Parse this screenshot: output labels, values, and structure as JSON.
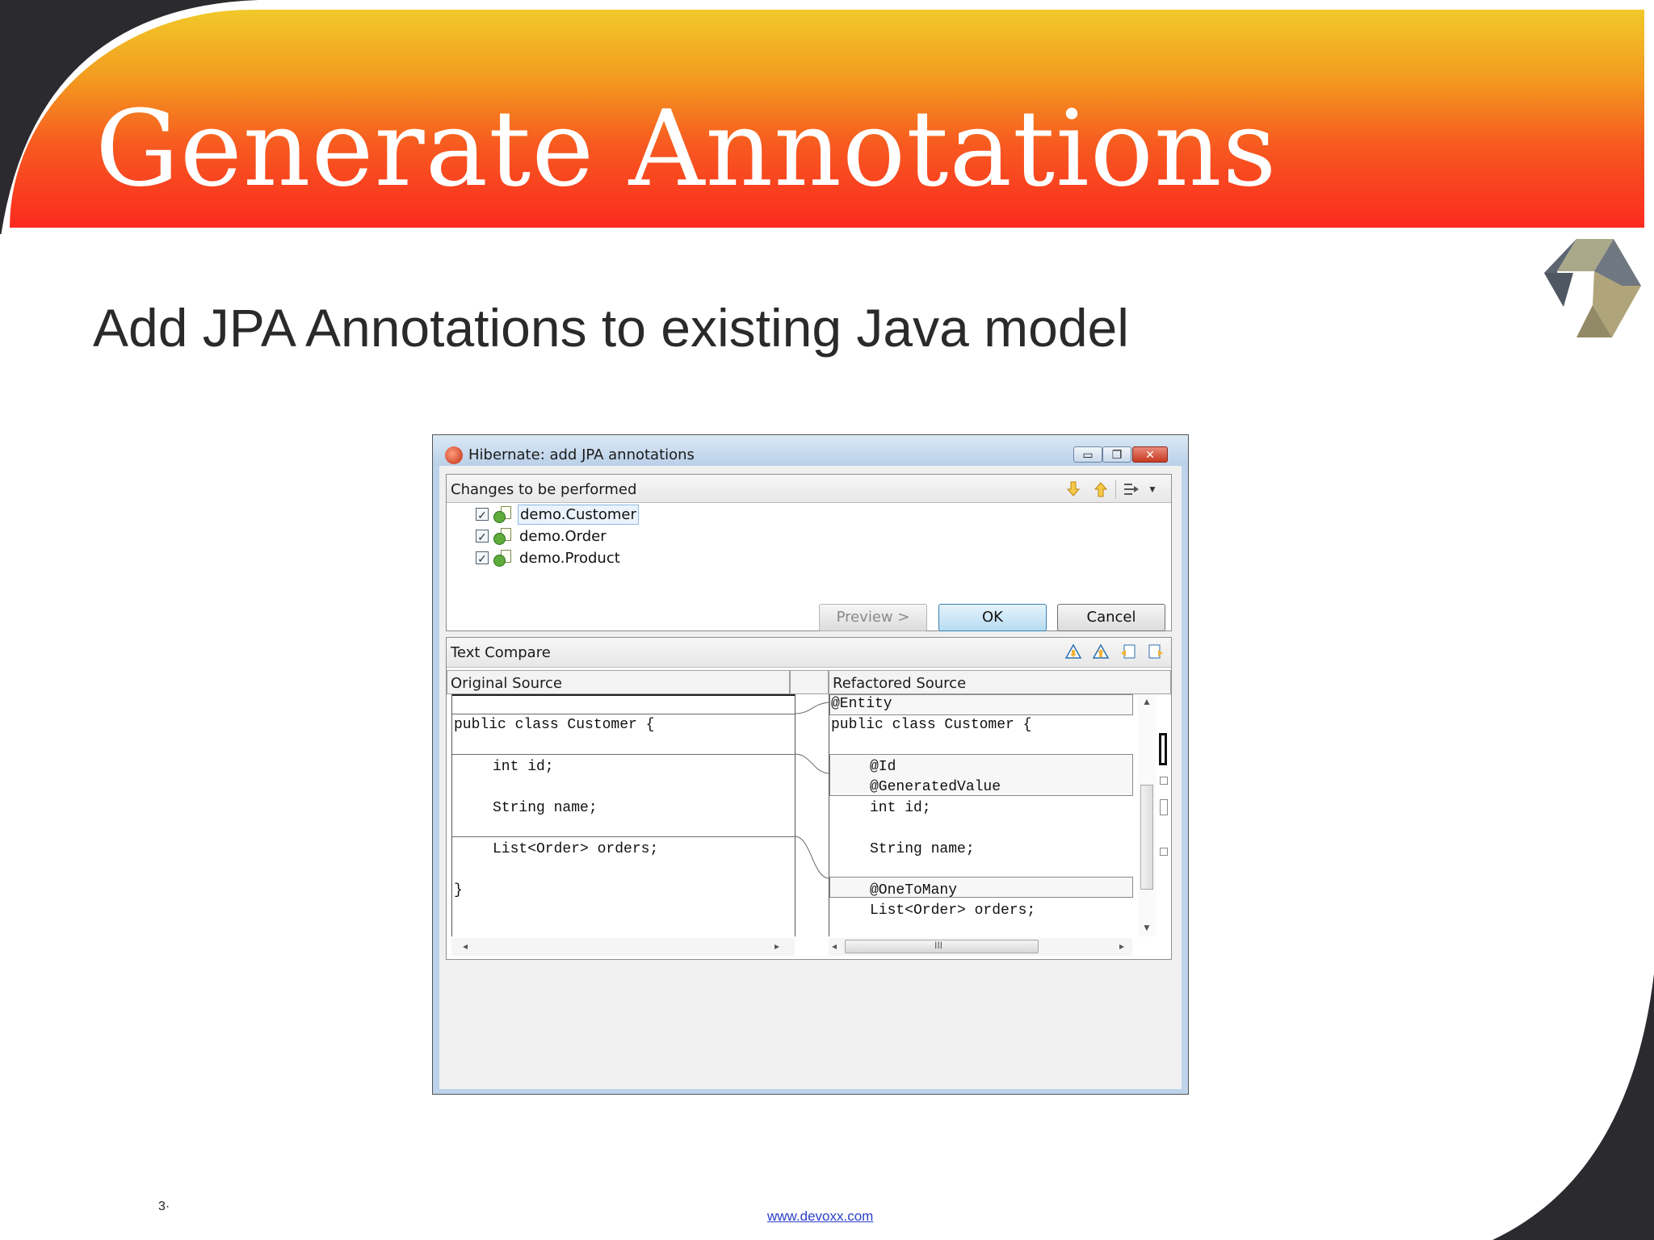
{
  "slide": {
    "title": "Generate Annotations",
    "subtitle": "Add JPA Annotations to existing Java model",
    "page_number": "3·",
    "footer_link": "www.devoxx.com"
  },
  "colors": {
    "header_top": "#f1c92a",
    "header_bottom": "#fb2a1f",
    "corner_dark": "#2b2b2f",
    "ok_button": "#b7dcf2"
  },
  "dialog": {
    "title": "Hibernate: add JPA annotations",
    "window_buttons": {
      "minimize": "▭",
      "maximize": "❐",
      "close": "✕"
    },
    "changes": {
      "header": "Changes to be performed",
      "toolbar_icons": [
        "arrow-down-icon",
        "arrow-up-icon",
        "filter-icon",
        "dropdown-icon"
      ],
      "items": [
        {
          "label": "demo.Customer",
          "checked": true,
          "selected": true
        },
        {
          "label": "demo.Order",
          "checked": true,
          "selected": false
        },
        {
          "label": "demo.Product",
          "checked": true,
          "selected": false
        }
      ]
    },
    "compare": {
      "header": "Text Compare",
      "toolbar_icons": [
        "next-diff-icon",
        "previous-diff-icon",
        "copy-left-icon",
        "copy-right-icon"
      ],
      "left_title": "Original Source",
      "right_title": "Refactored Source",
      "left_lines": [
        "public class Customer {",
        "int id;",
        "String name;",
        "List<Order> orders;",
        "}"
      ],
      "right_lines": [
        "@Entity",
        "public class Customer {",
        "@Id",
        "@GeneratedValue",
        "int id;",
        "String name;",
        "@OneToMany",
        "List<Order> orders;"
      ],
      "scroll_glyph": "III"
    },
    "buttons": {
      "preview": "Preview >",
      "ok": "OK",
      "cancel": "Cancel"
    }
  }
}
